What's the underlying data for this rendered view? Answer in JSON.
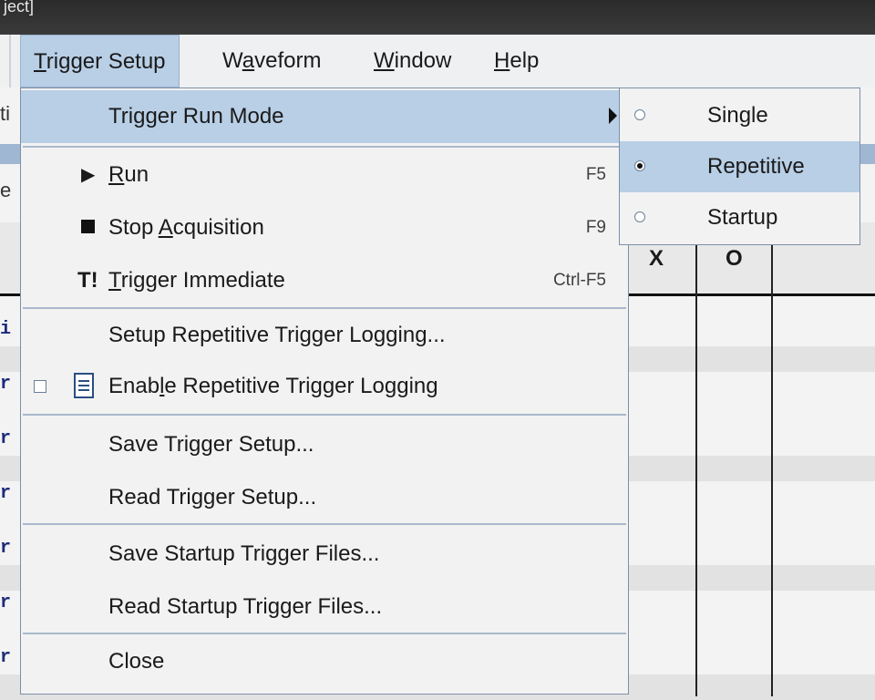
{
  "window": {
    "title_fragment": "ject]"
  },
  "menubar": {
    "items": [
      {
        "label": "Trigger Setup",
        "underline": "T",
        "rest": "rigger Setup",
        "active": true
      },
      {
        "label": "Waveform",
        "pre": "W",
        "underline": "a",
        "rest": "veform"
      },
      {
        "label": "Window",
        "underline": "W",
        "rest": "indow"
      },
      {
        "label": "Help",
        "underline": "H",
        "rest": "elp"
      }
    ]
  },
  "dropdown": {
    "trigger_run_mode": "Trigger Run Mode",
    "run": {
      "underline": "R",
      "rest": "un",
      "shortcut": "F5"
    },
    "stop": {
      "pre": "Stop ",
      "underline": "A",
      "rest": "cquisition",
      "shortcut": "F9"
    },
    "trigger_immediate": {
      "icon_text": "T!",
      "underline": "T",
      "rest": "rigger Immediate",
      "shortcut": "Ctrl-F5"
    },
    "setup_logging": "Setup Repetitive Trigger Logging...",
    "enable_logging": {
      "pre": "Enab",
      "underline": "l",
      "rest": "e Repetitive Trigger Logging"
    },
    "save_setup": "Save Trigger Setup...",
    "read_setup": "Read Trigger Setup...",
    "save_startup": "Save Startup Trigger Files...",
    "read_startup": "Read Startup Trigger Files...",
    "close": "Close"
  },
  "submenu": {
    "items": [
      {
        "label": "Single",
        "selected": false
      },
      {
        "label": "Repetitive",
        "selected": true
      },
      {
        "label": "Startup",
        "selected": false
      }
    ]
  },
  "table": {
    "col_x": "X",
    "col_o": "O"
  },
  "edge": {
    "left_char_top": "ti",
    "left_char_mid": "e"
  },
  "row_prefix_chars": [
    "i",
    "r",
    "r",
    "r",
    "r",
    "r",
    "r"
  ],
  "colors": {
    "highlight": "#b8cfe6",
    "menu_bg": "#f2f2f2",
    "border": "#7d8fa6"
  }
}
